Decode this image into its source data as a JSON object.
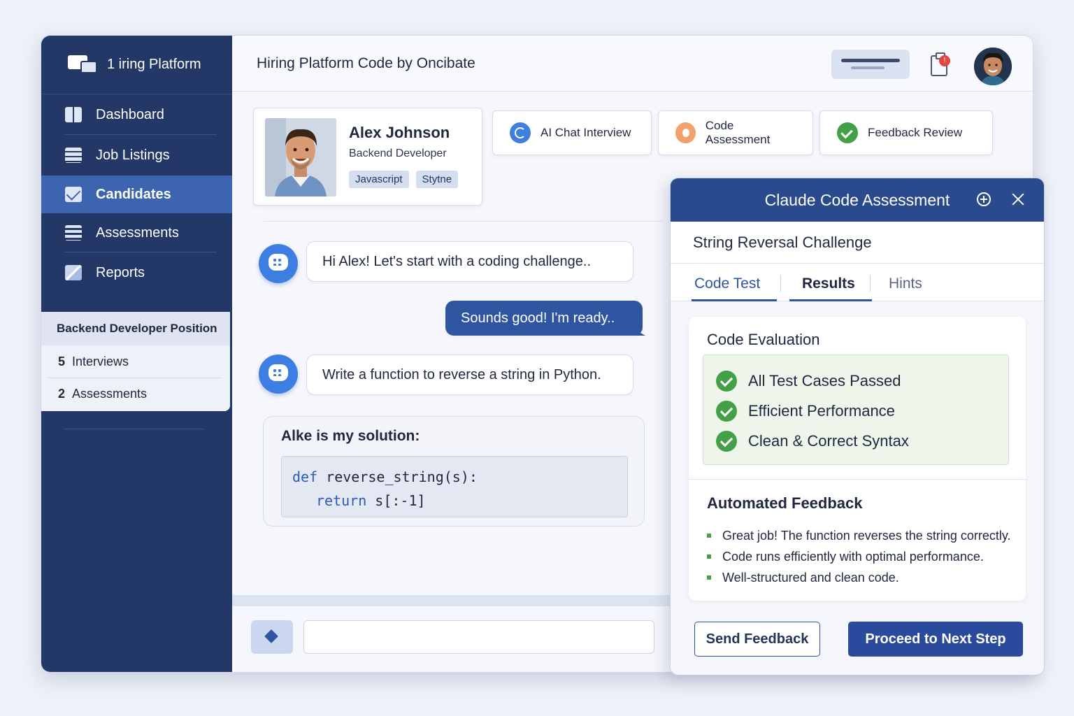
{
  "sidebar": {
    "brand": "1 iring Platform",
    "items": [
      {
        "label": "Dashboard",
        "icon": "book-icon"
      },
      {
        "label": "Job Listings",
        "icon": "table-icon"
      },
      {
        "label": "Candidates",
        "icon": "mail-icon",
        "active": true
      },
      {
        "label": "Assessments",
        "icon": "list-icon"
      },
      {
        "label": "Reports",
        "icon": "pen-icon"
      }
    ],
    "position": {
      "title": "Backend Developer Position",
      "stats": [
        {
          "count": "5",
          "label": "Interviews"
        },
        {
          "count": "2",
          "label": "Assessments"
        }
      ]
    }
  },
  "header": {
    "title": "Hiring Platform Code by Oncibate",
    "notification_count": "!"
  },
  "candidate": {
    "name": "Alex Johnson",
    "role": "Backend Developer",
    "tags": [
      "Javascript",
      "Stytne"
    ]
  },
  "stages": [
    {
      "label": "AI Chat Interview",
      "icon": "chat-icon"
    },
    {
      "label": "Code Assessment",
      "icon": "code-icon"
    },
    {
      "label": "Feedback Review",
      "icon": "check-icon"
    }
  ],
  "chat": {
    "messages": [
      {
        "from": "bot",
        "text": "Hi Alex! Let's start with a coding challenge.."
      },
      {
        "from": "user",
        "text": "Sounds good! I'm ready.."
      },
      {
        "from": "bot",
        "text": "Write a function to reverse a string in Python."
      }
    ],
    "solution_label": "Alke is my solution:",
    "code": {
      "line1_kw": "def",
      "line1_rest": " reverse_string(s):",
      "line2_kw": "return",
      "line2_rest": " s[:-1]"
    },
    "input_value": ""
  },
  "panel": {
    "title": "Claude Code Assessment",
    "challenge": "String Reversal Challenge",
    "tabs": [
      "Code Test",
      "Results",
      "Hints"
    ],
    "evaluation_title": "Code Evaluation",
    "results": [
      "All Test Cases Passed",
      "Efficient Performance",
      "Clean & Correct Syntax"
    ],
    "feedback_title": "Automated Feedback",
    "feedback": [
      "Great job! The function reverses the string correctly.",
      "Code runs efficiently with optimal performance.",
      "Well-structured and clean code."
    ],
    "send_label": "Send Feedback",
    "proceed_label": "Proceed to Next Step"
  },
  "colors": {
    "sidebar": "#233866",
    "active": "#3d64ae",
    "primary": "#2a4a8e",
    "success": "#43a047"
  }
}
